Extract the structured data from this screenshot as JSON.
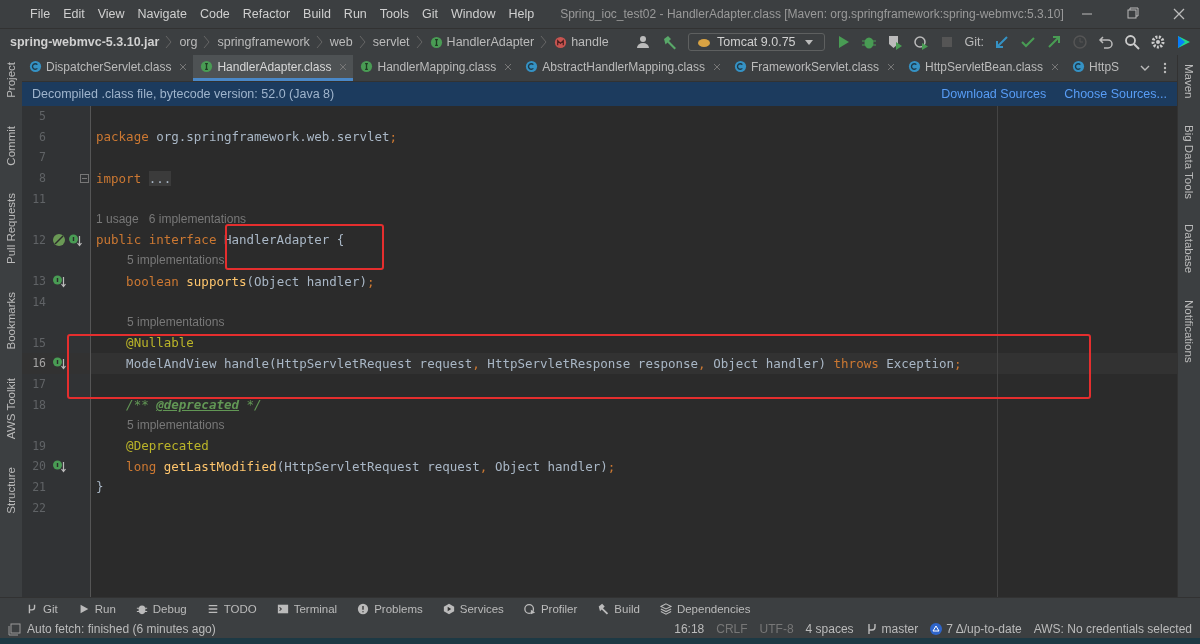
{
  "window": {
    "title": "Spring_ioc_test02 - HandlerAdapter.class [Maven: org.springframework:spring-webmvc:5.3.10]"
  },
  "menu": [
    "File",
    "Edit",
    "View",
    "Navigate",
    "Code",
    "Refactor",
    "Build",
    "Run",
    "Tools",
    "Git",
    "Window",
    "Help"
  ],
  "breadcrumbs": [
    {
      "label": "spring-webmvc-5.3.10.jar",
      "kind": "jar"
    },
    {
      "label": "org",
      "kind": "package"
    },
    {
      "label": "springframework",
      "kind": "package"
    },
    {
      "label": "web",
      "kind": "package"
    },
    {
      "label": "servlet",
      "kind": "package"
    },
    {
      "label": "HandlerAdapter",
      "kind": "interface"
    },
    {
      "label": "handle",
      "kind": "method"
    }
  ],
  "run_config": "Tomcat 9.0.75",
  "git_label": "Git:",
  "left_tools": [
    "Project",
    "Commit",
    "Pull Requests",
    "Bookmarks",
    "AWS Toolkit",
    "Structure"
  ],
  "right_tools": [
    "Maven",
    "Big Data Tools",
    "Database",
    "Notifications"
  ],
  "tabs": [
    {
      "label": "DispatcherServlet.class",
      "kind": "class",
      "selected": false
    },
    {
      "label": "HandlerAdapter.class",
      "kind": "interface",
      "selected": true
    },
    {
      "label": "HandlerMapping.class",
      "kind": "interface",
      "selected": false
    },
    {
      "label": "AbstractHandlerMapping.class",
      "kind": "class",
      "selected": false
    },
    {
      "label": "FrameworkServlet.class",
      "kind": "class",
      "selected": false
    },
    {
      "label": "HttpServletBean.class",
      "kind": "class",
      "selected": false
    },
    {
      "label": "HttpS",
      "kind": "class",
      "selected": false
    }
  ],
  "banner": {
    "text": "Decompiled .class file, bytecode version: 52.0 (Java 8)",
    "links": [
      "Download Sources",
      "Choose Sources..."
    ]
  },
  "lines": [
    {
      "kind": "code",
      "n": "5",
      "current": false
    },
    {
      "kind": "code",
      "n": "6",
      "current": false,
      "tokens": [
        {
          "text": "package ",
          "kind": "keyword"
        },
        {
          "text": "org.springframework.web.servlet",
          "kind": "plain"
        },
        {
          "text": ";",
          "kind": "keyword"
        }
      ]
    },
    {
      "kind": "code",
      "n": "7",
      "current": false
    },
    {
      "kind": "code",
      "n": "8",
      "current": false,
      "gutter": [
        {
          "kind": "fold"
        }
      ],
      "tokens": [
        {
          "text": "import ",
          "kind": "keyword"
        },
        {
          "text": "...",
          "kind": "folded"
        }
      ]
    },
    {
      "kind": "code",
      "n": "11",
      "current": false
    },
    {
      "kind": "hint",
      "indented": false,
      "text": "1 usage   6 implementations"
    },
    {
      "kind": "code",
      "n": "12",
      "current": false,
      "gutter": [
        {
          "kind": "bean"
        },
        {
          "kind": "implemented"
        }
      ],
      "tokens": [
        {
          "text": "public interface ",
          "kind": "keyword"
        },
        {
          "text": "HandlerAdapter {",
          "kind": "plain"
        }
      ]
    },
    {
      "kind": "hint",
      "indented": true,
      "text": "5 implementations"
    },
    {
      "kind": "code",
      "n": "13",
      "current": false,
      "gutter": [
        {
          "kind": "implemented"
        }
      ],
      "tokens": [
        {
          "text": "    boolean ",
          "kind": "keyword"
        },
        {
          "text": "supports",
          "kind": "declaration"
        },
        {
          "text": "(Object handler)",
          "kind": "plain"
        },
        {
          "text": ";",
          "kind": "keyword"
        }
      ]
    },
    {
      "kind": "code",
      "n": "14",
      "current": false
    },
    {
      "kind": "hint",
      "indented": true,
      "text": "5 implementations"
    },
    {
      "kind": "code",
      "n": "15",
      "current": false,
      "tokens": [
        {
          "text": "    @Nullable",
          "kind": "annotation"
        }
      ]
    },
    {
      "kind": "code",
      "n": "16",
      "current": true,
      "gutter": [
        {
          "kind": "implemented"
        }
      ],
      "tokens": [
        {
          "text": "    ModelAndView handle(HttpServletRequest request",
          "kind": "plain"
        },
        {
          "text": ", ",
          "kind": "keyword"
        },
        {
          "text": "HttpServletResponse response",
          "kind": "plain"
        },
        {
          "text": ", ",
          "kind": "keyword"
        },
        {
          "text": "Object handler) ",
          "kind": "plain"
        },
        {
          "text": "throws ",
          "kind": "keyword"
        },
        {
          "text": "Exception",
          "kind": "plain"
        },
        {
          "text": ";",
          "kind": "keyword"
        }
      ]
    },
    {
      "kind": "code",
      "n": "17",
      "current": false
    },
    {
      "kind": "code",
      "n": "18",
      "current": false,
      "tokens": [
        {
          "text": "    /** ",
          "kind": "comment"
        },
        {
          "text": "@deprecated",
          "kind": "doctag"
        },
        {
          "text": " */",
          "kind": "comment"
        }
      ]
    },
    {
      "kind": "hint",
      "indented": true,
      "text": "5 implementations"
    },
    {
      "kind": "code",
      "n": "19",
      "current": false,
      "tokens": [
        {
          "text": "    @Deprecated",
          "kind": "annotation"
        }
      ]
    },
    {
      "kind": "code",
      "n": "20",
      "current": false,
      "gutter": [
        {
          "kind": "implemented"
        }
      ],
      "tokens": [
        {
          "text": "    long ",
          "kind": "keyword"
        },
        {
          "text": "getLastModified",
          "kind": "declaration"
        },
        {
          "text": "(HttpServletRequest request",
          "kind": "plain"
        },
        {
          "text": ", ",
          "kind": "keyword"
        },
        {
          "text": "Object handler)",
          "kind": "plain"
        },
        {
          "text": ";",
          "kind": "keyword"
        }
      ]
    },
    {
      "kind": "code",
      "n": "21",
      "current": false,
      "tokens": [
        {
          "text": "}",
          "kind": "plain"
        }
      ]
    },
    {
      "kind": "code",
      "n": "22",
      "current": false
    }
  ],
  "tool_windows": [
    {
      "label": "Git",
      "kind": "git"
    },
    {
      "label": "Run",
      "kind": "run"
    },
    {
      "label": "Debug",
      "kind": "debug"
    },
    {
      "label": "TODO",
      "kind": "todo"
    },
    {
      "label": "Terminal",
      "kind": "terminal"
    },
    {
      "label": "Problems",
      "kind": "problems"
    },
    {
      "label": "Services",
      "kind": "services"
    },
    {
      "label": "Profiler",
      "kind": "profiler"
    },
    {
      "label": "Build",
      "kind": "build"
    },
    {
      "label": "Dependencies",
      "kind": "deps"
    }
  ],
  "status_bar": {
    "message": "Auto fetch: finished (6 minutes ago)",
    "items": [
      {
        "text": "16:18",
        "kind": "plain"
      },
      {
        "text": "CRLF",
        "kind": "dim"
      },
      {
        "text": "UTF-8",
        "kind": "dim"
      },
      {
        "text": "4 spaces",
        "kind": "plain"
      },
      {
        "text": "master",
        "kind": "branch"
      },
      {
        "text": "7 Δ/up-to-date",
        "kind": "vcs"
      },
      {
        "text": "AWS: No credentials selected",
        "kind": "plain"
      }
    ]
  }
}
